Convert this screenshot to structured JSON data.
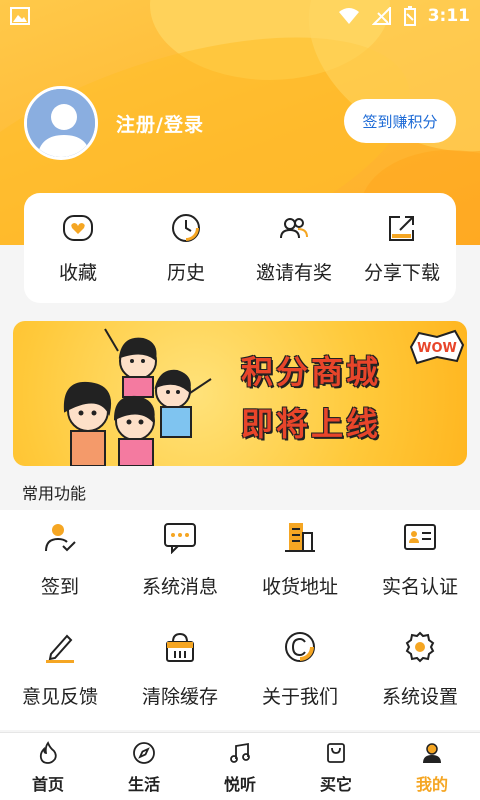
{
  "status_bar": {
    "time": "3:11"
  },
  "profile": {
    "login_label": "注册/登录",
    "signin_button": "签到赚积分"
  },
  "quick_actions": [
    {
      "label": "收藏",
      "icon": "heart-icon"
    },
    {
      "label": "历史",
      "icon": "clock-icon"
    },
    {
      "label": "邀请有奖",
      "icon": "users-icon"
    },
    {
      "label": "分享下载",
      "icon": "share-icon"
    }
  ],
  "banner": {
    "line1": "积分商城",
    "line2": "即将上线",
    "badge": "WOW"
  },
  "common_functions": {
    "title": "常用功能",
    "items": [
      {
        "label": "签到",
        "icon": "user-check-icon"
      },
      {
        "label": "系统消息",
        "icon": "message-icon"
      },
      {
        "label": "收货地址",
        "icon": "building-icon"
      },
      {
        "label": "实名认证",
        "icon": "id-card-icon"
      },
      {
        "label": "意见反馈",
        "icon": "pencil-icon"
      },
      {
        "label": "清除缓存",
        "icon": "basket-icon"
      },
      {
        "label": "关于我们",
        "icon": "copyright-icon"
      },
      {
        "label": "系统设置",
        "icon": "gear-icon"
      }
    ]
  },
  "bottom_nav": [
    {
      "label": "首页",
      "icon": "flame-icon",
      "active": false
    },
    {
      "label": "生活",
      "icon": "compass-icon",
      "active": false
    },
    {
      "label": "悦听",
      "icon": "music-icon",
      "active": false
    },
    {
      "label": "买它",
      "icon": "shopping-bag-icon",
      "active": false
    },
    {
      "label": "我的",
      "icon": "user-icon",
      "active": true
    }
  ],
  "colors": {
    "accent": "#f5a623",
    "header": "#ffbb33",
    "link_blue": "#1e6bd6",
    "banner_text": "#e8452a"
  }
}
